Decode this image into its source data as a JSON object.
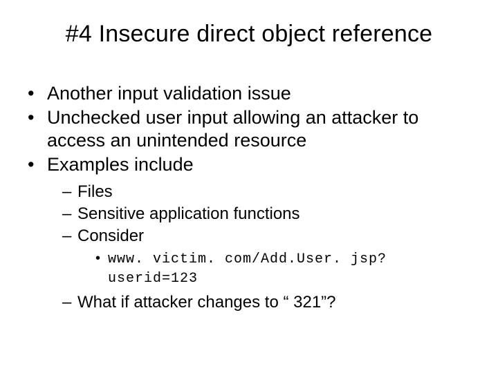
{
  "title": "#4 Insecure direct object reference",
  "bullets": {
    "b1": "Another input validation issue",
    "b2": "Unchecked user input allowing an attacker to access an unintended resource",
    "b3": "Examples include",
    "sub": {
      "s1": "Files",
      "s2": "Sensitive application functions",
      "s3": "Consider",
      "code": "www. victim. com/Add.User. jsp? userid=123",
      "s4": "What if attacker changes to “ 321”?"
    }
  }
}
